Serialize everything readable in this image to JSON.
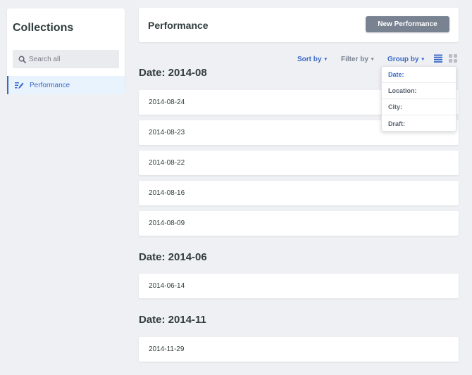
{
  "sidebar": {
    "title": "Collections",
    "search_placeholder": "Search all",
    "items": [
      {
        "label": "Performance",
        "icon": "edit-list-icon",
        "active": true
      }
    ]
  },
  "header": {
    "title": "Performance",
    "new_button_label": "New Performance"
  },
  "toolbar": {
    "sort_label": "Sort by",
    "filter_label": "Filter by",
    "group_label": "Group by",
    "caret": "▾",
    "view_modes": [
      "list-view-icon",
      "grid-view-icon"
    ],
    "active_view": "list"
  },
  "group_dropdown": {
    "options": [
      "Date:",
      "Location:",
      "City:",
      "Draft:"
    ],
    "selected": "Date:"
  },
  "groups": [
    {
      "title": "Date: 2014-08",
      "rows": [
        "2014-08-24",
        "2014-08-23",
        "2014-08-22",
        "2014-08-16",
        "2014-08-09"
      ]
    },
    {
      "title": "Date: 2014-06",
      "rows": [
        "2014-06-14"
      ]
    },
    {
      "title": "Date: 2014-11",
      "rows": [
        "2014-11-29"
      ]
    }
  ],
  "colors": {
    "accent": "#3a69c7",
    "button": "#798291",
    "background": "#eff0f4",
    "selected_item_bg": "#e8f3fd"
  }
}
